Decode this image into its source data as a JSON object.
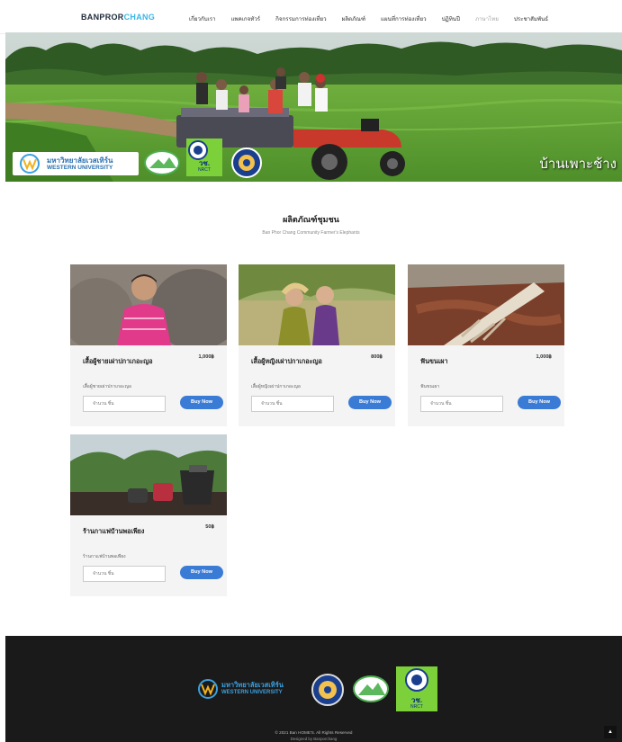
{
  "nav": {
    "brand_part1": "BANPROR",
    "brand_part2": "CHANG",
    "items": [
      {
        "label": "เกี่ยวกับเรา"
      },
      {
        "label": "แพคเกจทัวร์"
      },
      {
        "label": "กิจกรรมการท่องเที่ยว"
      },
      {
        "label": "ผลิตภัณฑ์"
      },
      {
        "label": "แผนที่การท่องเที่ยว"
      },
      {
        "label": "ปฏิทินปี"
      },
      {
        "label": "ภาษาไทย"
      },
      {
        "label": "ประชาสัมพันธ์"
      }
    ],
    "brand_colors": {
      "primary": "#1d2a3a",
      "accent": "#39b6e6"
    }
  },
  "hero": {
    "caption": "บ้านเพาะช้าง",
    "logos": [
      "university-logo",
      "community-logo",
      "nrct-logo",
      "round-seal-logo"
    ],
    "university_thai": "มหาวิทยาลัยเวสเทิร์น",
    "university_en": "WESTERN UNIVERSITY",
    "nrct_thai": "วช.",
    "nrct_en": "NRCT"
  },
  "section": {
    "title": "ผลิตภัณฑ์ชุมชน",
    "subtitle": "Ban Phor Chang Community Farmer's Elephants"
  },
  "products": [
    {
      "title": "เสื้อผู้ชายเผ่าปกาเกอะญอ",
      "price": "1,000฿",
      "desc": "เสื้อผู้ชายเผ่าปกาเกอะญอ",
      "qty_placeholder": "จำนวน ชิ้น",
      "buy": "Buy Now"
    },
    {
      "title": "เสื้อผู้หญิงเผ่าปกาเกอะญอ",
      "price": "800฿",
      "desc": "เสื้อผู้หญิงเผ่าปกาเกอะญอ",
      "qty_placeholder": "จำนวน ชิ้น",
      "buy": "Buy Now"
    },
    {
      "title": "ฟันขนเผา",
      "price": "1,000฿",
      "desc": "ฟันขนเผา",
      "qty_placeholder": "จำนวน ชิ้น",
      "buy": "Buy Now"
    },
    {
      "title": "ร้านกาแฟบ้านพอเพียง",
      "price": "50฿",
      "desc": "ร้านกาแฟบ้านพอเพียง",
      "qty_placeholder": "จำนวน ชิ้น",
      "buy": "Buy Now"
    }
  ],
  "footer": {
    "copyright": "© 2021 Ban HOME'S. All Rights Reserved",
    "designed": "Designed by Banporchang",
    "university_thai": "มหาวิทยาลัยเวสเทิร์น",
    "university_en": "WESTERN UNIVERSITY",
    "nrct_thai": "วช.",
    "nrct_en": "NRCT",
    "to_top": "▲"
  },
  "colors": {
    "buy_button": "#3a7bd5",
    "footer_bg": "#1a1a1a",
    "card_bg": "#f4f4f4"
  }
}
